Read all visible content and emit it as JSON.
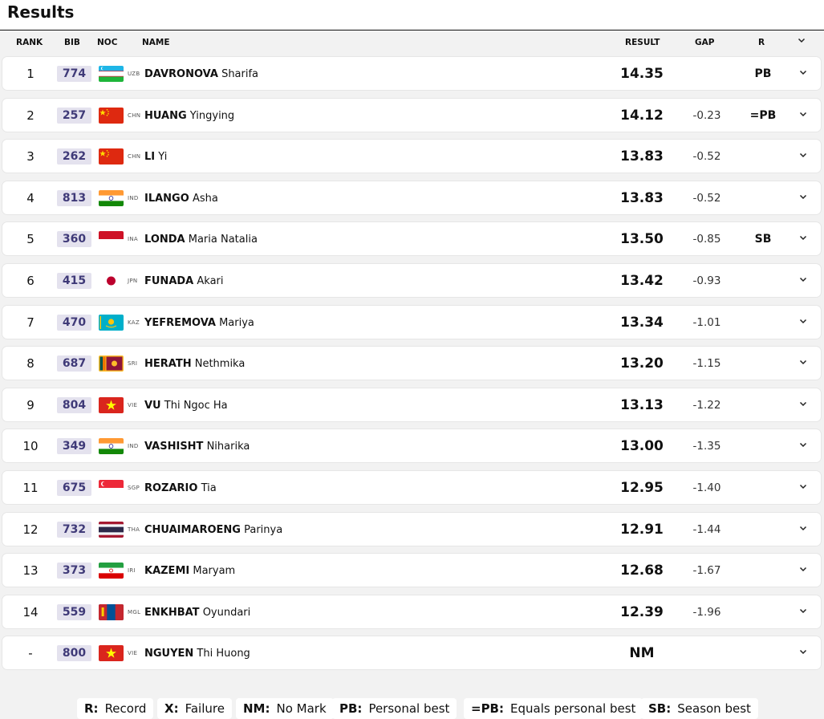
{
  "page": {
    "title": "Results"
  },
  "columns": {
    "rank": "RANK",
    "bib": "BIB",
    "noc": "NOC",
    "name": "NAME",
    "result": "RESULT",
    "gap": "GAP",
    "record": "R"
  },
  "icons": {
    "expand": "chevron-down-icon"
  },
  "rows": [
    {
      "rank": "1",
      "bib": "774",
      "noc": "UZB",
      "last": "DAVRONOVA",
      "first": "Sharifa",
      "result": "14.35",
      "gap": "",
      "record": "PB"
    },
    {
      "rank": "2",
      "bib": "257",
      "noc": "CHN",
      "last": "HUANG",
      "first": "Yingying",
      "result": "14.12",
      "gap": "-0.23",
      "record": "=PB"
    },
    {
      "rank": "3",
      "bib": "262",
      "noc": "CHN",
      "last": "LI",
      "first": "Yi",
      "result": "13.83",
      "gap": "-0.52",
      "record": ""
    },
    {
      "rank": "4",
      "bib": "813",
      "noc": "IND",
      "last": "ILANGO",
      "first": "Asha",
      "result": "13.83",
      "gap": "-0.52",
      "record": ""
    },
    {
      "rank": "5",
      "bib": "360",
      "noc": "INA",
      "last": "LONDA",
      "first": "Maria Natalia",
      "result": "13.50",
      "gap": "-0.85",
      "record": "SB"
    },
    {
      "rank": "6",
      "bib": "415",
      "noc": "JPN",
      "last": "FUNADA",
      "first": "Akari",
      "result": "13.42",
      "gap": "-0.93",
      "record": ""
    },
    {
      "rank": "7",
      "bib": "470",
      "noc": "KAZ",
      "last": "YEFREMOVA",
      "first": "Mariya",
      "result": "13.34",
      "gap": "-1.01",
      "record": ""
    },
    {
      "rank": "8",
      "bib": "687",
      "noc": "SRI",
      "last": "HERATH",
      "first": "Nethmika",
      "result": "13.20",
      "gap": "-1.15",
      "record": ""
    },
    {
      "rank": "9",
      "bib": "804",
      "noc": "VIE",
      "last": "VU",
      "first": "Thi Ngoc Ha",
      "result": "13.13",
      "gap": "-1.22",
      "record": ""
    },
    {
      "rank": "10",
      "bib": "349",
      "noc": "IND",
      "last": "VASHISHT",
      "first": "Niharika",
      "result": "13.00",
      "gap": "-1.35",
      "record": ""
    },
    {
      "rank": "11",
      "bib": "675",
      "noc": "SGP",
      "last": "ROZARIO",
      "first": "Tia",
      "result": "12.95",
      "gap": "-1.40",
      "record": ""
    },
    {
      "rank": "12",
      "bib": "732",
      "noc": "THA",
      "last": "CHUAIMAROENG",
      "first": "Parinya",
      "result": "12.91",
      "gap": "-1.44",
      "record": ""
    },
    {
      "rank": "13",
      "bib": "373",
      "noc": "IRI",
      "last": "KAZEMI",
      "first": "Maryam",
      "result": "12.68",
      "gap": "-1.67",
      "record": ""
    },
    {
      "rank": "14",
      "bib": "559",
      "noc": "MGL",
      "last": "ENKHBAT",
      "first": "Oyundari",
      "result": "12.39",
      "gap": "-1.96",
      "record": ""
    },
    {
      "rank": "-",
      "bib": "800",
      "noc": "VIE",
      "last": "NGUYEN",
      "first": "Thi Huong",
      "result": "NM",
      "gap": "",
      "record": ""
    }
  ],
  "legend": [
    {
      "key": "R:",
      "label": "Record"
    },
    {
      "key": "X:",
      "label": "Failure"
    },
    {
      "key": "NM:",
      "label": "No Mark"
    },
    {
      "key": "PB:",
      "label": "Personal best"
    },
    {
      "key": "=PB:",
      "label": "Equals personal best"
    },
    {
      "key": "SB:",
      "label": "Season best"
    }
  ]
}
